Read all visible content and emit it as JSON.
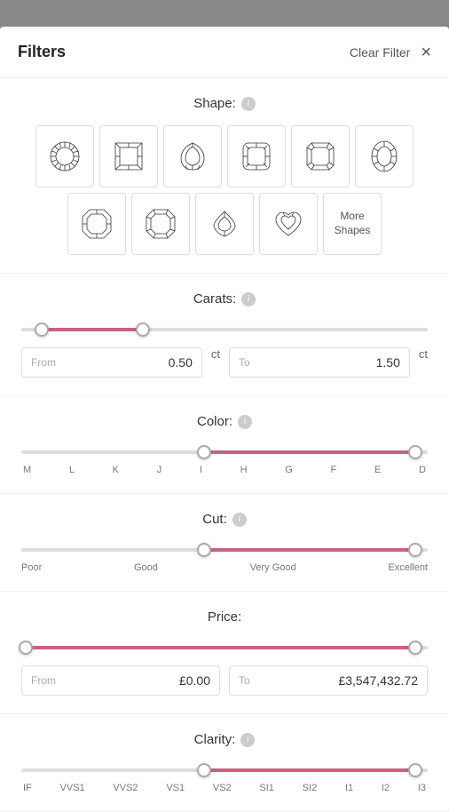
{
  "header": {
    "title": "Filters",
    "clear_filter_label": "Clear Filter",
    "close_icon": "×"
  },
  "shape_section": {
    "title": "Shape:",
    "shapes": [
      {
        "name": "Round",
        "id": "round"
      },
      {
        "name": "Princess",
        "id": "princess"
      },
      {
        "name": "Pear",
        "id": "pear"
      },
      {
        "name": "Cushion",
        "id": "cushion"
      },
      {
        "name": "Radiant",
        "id": "radiant"
      },
      {
        "name": "Oval",
        "id": "oval"
      },
      {
        "name": "Emerald",
        "id": "emerald"
      },
      {
        "name": "Asscher",
        "id": "asscher"
      },
      {
        "name": "Marquise",
        "id": "marquise"
      },
      {
        "name": "Heart",
        "id": "heart"
      },
      {
        "name": "More Shapes",
        "id": "more"
      }
    ]
  },
  "carats_section": {
    "title": "Carats:",
    "from_label": "From",
    "to_label": "To",
    "from_value": "0.50",
    "to_value": "1.50",
    "unit": "ct",
    "thumb_left_pct": 5,
    "thumb_right_pct": 30,
    "fill_left_pct": 5,
    "fill_width_pct": 25
  },
  "color_section": {
    "title": "Color:",
    "labels": [
      "M",
      "L",
      "K",
      "J",
      "I",
      "H",
      "G",
      "F",
      "E",
      "D"
    ],
    "thumb_left_pct": 45,
    "thumb_right_pct": 97,
    "fill_left_pct": 45,
    "fill_width_pct": 52
  },
  "cut_section": {
    "title": "Cut:",
    "labels": [
      "Poor",
      "Good",
      "Very Good",
      "Excellent"
    ],
    "thumb_left_pct": 45,
    "thumb_right_pct": 97,
    "fill_left_pct": 45,
    "fill_width_pct": 52
  },
  "price_section": {
    "title": "Price:",
    "from_label": "From",
    "to_label": "To",
    "from_value": "£0.00",
    "to_value": "£3,547,432.72",
    "thumb_left_pct": 1,
    "thumb_right_pct": 97,
    "fill_left_pct": 1,
    "fill_width_pct": 96
  },
  "clarity_section": {
    "title": "Clarity:",
    "thumb_pct": 45,
    "thumb_left_pct": 45,
    "thumb_right_pct": 97,
    "fill_left_pct": 45,
    "fill_width_pct": 52,
    "labels": [
      "IF",
      "VVS1",
      "VVS2",
      "VS1",
      "VS2",
      "SI1",
      "SI2",
      "I1",
      "I2",
      "I3"
    ]
  }
}
